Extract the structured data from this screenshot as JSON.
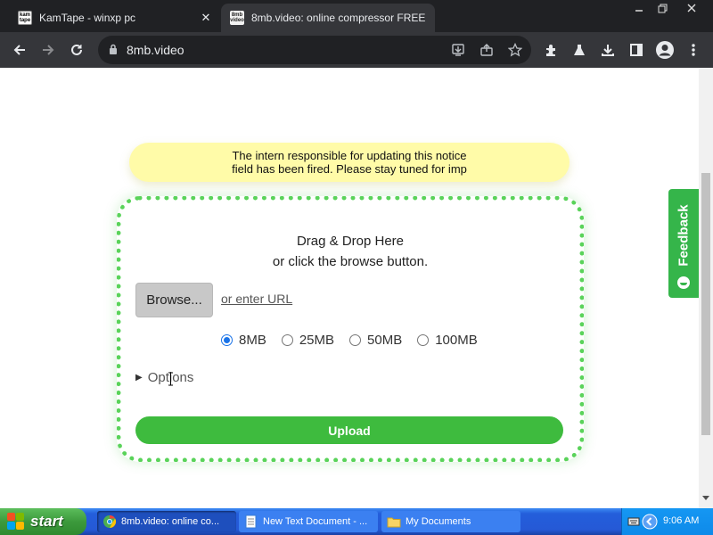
{
  "browser": {
    "tabs": [
      {
        "favicon": "kamtape-favicon",
        "favicon_text": "kam tape",
        "title": "KamTape - winxp pc",
        "active": false
      },
      {
        "favicon": "8mb-favicon",
        "favicon_text": "8mb video",
        "title": "8mb.video: online compressor FREE",
        "active": true
      }
    ],
    "url": "8mb.video",
    "toolbar_icons": [
      "back-icon",
      "forward-icon",
      "reload-icon",
      "lock-icon",
      "install-icon",
      "share-icon",
      "bookmark-star-icon",
      "extensions-icon",
      "labs-flask-icon",
      "downloads-icon",
      "side-panel-icon",
      "profile-icon",
      "menu-icon"
    ]
  },
  "page": {
    "notice": {
      "line1": "The intern responsible for updating this notice",
      "line2": "field has been fired. Please stay tuned for imp"
    },
    "dropzone": {
      "title_line1": "Drag & Drop Here",
      "title_line2": "or click the browse button.",
      "browse_label": "Browse...",
      "enter_url_label": "or enter URL",
      "sizes": [
        {
          "label": "8MB",
          "checked": true
        },
        {
          "label": "25MB",
          "checked": false
        },
        {
          "label": "50MB",
          "checked": false
        },
        {
          "label": "100MB",
          "checked": false
        }
      ],
      "options_label": "Options",
      "upload_label": "Upload"
    },
    "feedback_label": "Feedback"
  },
  "taskbar": {
    "start_label": "start",
    "tasks": [
      {
        "label": "8mb.video: online co...",
        "icon": "chrome-icon",
        "active": true
      },
      {
        "label": "New Text Document - ...",
        "icon": "notepad-icon",
        "active": false
      },
      {
        "label": "My Documents",
        "icon": "folder-icon",
        "active": false
      }
    ],
    "clock": "9:06 AM"
  },
  "colors": {
    "accent_green": "#3ebb3e",
    "dotted_border": "#5ad35a",
    "notice_bg": "#fffba8",
    "feedback_bg": "#35b54a",
    "radio_accent": "#1a73e8"
  }
}
